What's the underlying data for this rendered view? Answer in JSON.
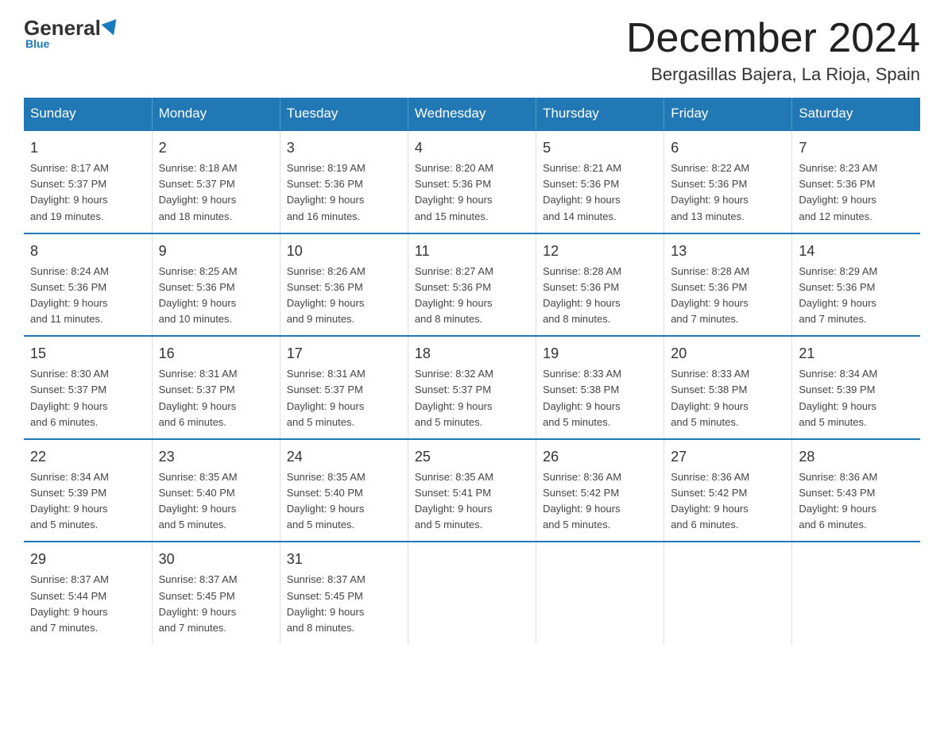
{
  "logo": {
    "general": "General",
    "blue": "Blue"
  },
  "header": {
    "month_year": "December 2024",
    "location": "Bergasillas Bajera, La Rioja, Spain"
  },
  "days_of_week": [
    "Sunday",
    "Monday",
    "Tuesday",
    "Wednesday",
    "Thursday",
    "Friday",
    "Saturday"
  ],
  "weeks": [
    [
      {
        "day": "1",
        "sunrise": "8:17 AM",
        "sunset": "5:37 PM",
        "daylight": "9 hours and 19 minutes."
      },
      {
        "day": "2",
        "sunrise": "8:18 AM",
        "sunset": "5:37 PM",
        "daylight": "9 hours and 18 minutes."
      },
      {
        "day": "3",
        "sunrise": "8:19 AM",
        "sunset": "5:36 PM",
        "daylight": "9 hours and 16 minutes."
      },
      {
        "day": "4",
        "sunrise": "8:20 AM",
        "sunset": "5:36 PM",
        "daylight": "9 hours and 15 minutes."
      },
      {
        "day": "5",
        "sunrise": "8:21 AM",
        "sunset": "5:36 PM",
        "daylight": "9 hours and 14 minutes."
      },
      {
        "day": "6",
        "sunrise": "8:22 AM",
        "sunset": "5:36 PM",
        "daylight": "9 hours and 13 minutes."
      },
      {
        "day": "7",
        "sunrise": "8:23 AM",
        "sunset": "5:36 PM",
        "daylight": "9 hours and 12 minutes."
      }
    ],
    [
      {
        "day": "8",
        "sunrise": "8:24 AM",
        "sunset": "5:36 PM",
        "daylight": "9 hours and 11 minutes."
      },
      {
        "day": "9",
        "sunrise": "8:25 AM",
        "sunset": "5:36 PM",
        "daylight": "9 hours and 10 minutes."
      },
      {
        "day": "10",
        "sunrise": "8:26 AM",
        "sunset": "5:36 PM",
        "daylight": "9 hours and 9 minutes."
      },
      {
        "day": "11",
        "sunrise": "8:27 AM",
        "sunset": "5:36 PM",
        "daylight": "9 hours and 8 minutes."
      },
      {
        "day": "12",
        "sunrise": "8:28 AM",
        "sunset": "5:36 PM",
        "daylight": "9 hours and 8 minutes."
      },
      {
        "day": "13",
        "sunrise": "8:28 AM",
        "sunset": "5:36 PM",
        "daylight": "9 hours and 7 minutes."
      },
      {
        "day": "14",
        "sunrise": "8:29 AM",
        "sunset": "5:36 PM",
        "daylight": "9 hours and 7 minutes."
      }
    ],
    [
      {
        "day": "15",
        "sunrise": "8:30 AM",
        "sunset": "5:37 PM",
        "daylight": "9 hours and 6 minutes."
      },
      {
        "day": "16",
        "sunrise": "8:31 AM",
        "sunset": "5:37 PM",
        "daylight": "9 hours and 6 minutes."
      },
      {
        "day": "17",
        "sunrise": "8:31 AM",
        "sunset": "5:37 PM",
        "daylight": "9 hours and 5 minutes."
      },
      {
        "day": "18",
        "sunrise": "8:32 AM",
        "sunset": "5:37 PM",
        "daylight": "9 hours and 5 minutes."
      },
      {
        "day": "19",
        "sunrise": "8:33 AM",
        "sunset": "5:38 PM",
        "daylight": "9 hours and 5 minutes."
      },
      {
        "day": "20",
        "sunrise": "8:33 AM",
        "sunset": "5:38 PM",
        "daylight": "9 hours and 5 minutes."
      },
      {
        "day": "21",
        "sunrise": "8:34 AM",
        "sunset": "5:39 PM",
        "daylight": "9 hours and 5 minutes."
      }
    ],
    [
      {
        "day": "22",
        "sunrise": "8:34 AM",
        "sunset": "5:39 PM",
        "daylight": "9 hours and 5 minutes."
      },
      {
        "day": "23",
        "sunrise": "8:35 AM",
        "sunset": "5:40 PM",
        "daylight": "9 hours and 5 minutes."
      },
      {
        "day": "24",
        "sunrise": "8:35 AM",
        "sunset": "5:40 PM",
        "daylight": "9 hours and 5 minutes."
      },
      {
        "day": "25",
        "sunrise": "8:35 AM",
        "sunset": "5:41 PM",
        "daylight": "9 hours and 5 minutes."
      },
      {
        "day": "26",
        "sunrise": "8:36 AM",
        "sunset": "5:42 PM",
        "daylight": "9 hours and 5 minutes."
      },
      {
        "day": "27",
        "sunrise": "8:36 AM",
        "sunset": "5:42 PM",
        "daylight": "9 hours and 6 minutes."
      },
      {
        "day": "28",
        "sunrise": "8:36 AM",
        "sunset": "5:43 PM",
        "daylight": "9 hours and 6 minutes."
      }
    ],
    [
      {
        "day": "29",
        "sunrise": "8:37 AM",
        "sunset": "5:44 PM",
        "daylight": "9 hours and 7 minutes."
      },
      {
        "day": "30",
        "sunrise": "8:37 AM",
        "sunset": "5:45 PM",
        "daylight": "9 hours and 7 minutes."
      },
      {
        "day": "31",
        "sunrise": "8:37 AM",
        "sunset": "5:45 PM",
        "daylight": "9 hours and 8 minutes."
      },
      null,
      null,
      null,
      null
    ]
  ],
  "labels": {
    "sunrise": "Sunrise:",
    "sunset": "Sunset:",
    "daylight": "Daylight:"
  }
}
